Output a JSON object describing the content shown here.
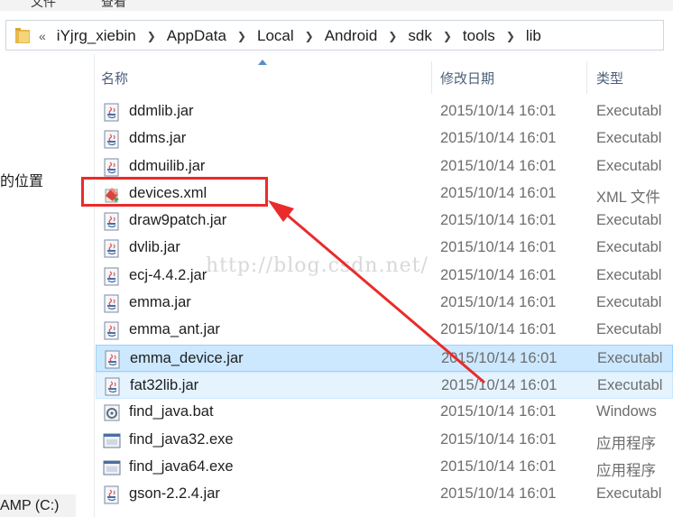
{
  "menu": {
    "items": [
      "文件",
      "查看"
    ]
  },
  "address": {
    "overflow": "«",
    "crumbs": [
      "iYjrg_xiebin",
      "AppData",
      "Local",
      "Android",
      "sdk",
      "tools",
      "lib"
    ]
  },
  "nav": {
    "location_fragment": "的位置",
    "drive_fragment": "AMP (C:)"
  },
  "columns": {
    "name": "名称",
    "date": "修改日期",
    "type": "类型"
  },
  "files": [
    {
      "name": "ddmlib.jar",
      "date": "2015/10/14 16:01",
      "type": "Executabl",
      "icon": "java-jar-icon"
    },
    {
      "name": "ddms.jar",
      "date": "2015/10/14 16:01",
      "type": "Executabl",
      "icon": "java-jar-icon"
    },
    {
      "name": "ddmuilib.jar",
      "date": "2015/10/14 16:01",
      "type": "Executabl",
      "icon": "java-jar-icon"
    },
    {
      "name": "devices.xml",
      "date": "2015/10/14 16:01",
      "type": "XML 文件",
      "icon": "xml-file-icon"
    },
    {
      "name": "draw9patch.jar",
      "date": "2015/10/14 16:01",
      "type": "Executabl",
      "icon": "java-jar-icon"
    },
    {
      "name": "dvlib.jar",
      "date": "2015/10/14 16:01",
      "type": "Executabl",
      "icon": "java-jar-icon"
    },
    {
      "name": "ecj-4.4.2.jar",
      "date": "2015/10/14 16:01",
      "type": "Executabl",
      "icon": "java-jar-icon"
    },
    {
      "name": "emma.jar",
      "date": "2015/10/14 16:01",
      "type": "Executabl",
      "icon": "java-jar-icon"
    },
    {
      "name": "emma_ant.jar",
      "date": "2015/10/14 16:01",
      "type": "Executabl",
      "icon": "java-jar-icon"
    },
    {
      "name": "emma_device.jar",
      "date": "2015/10/14 16:01",
      "type": "Executabl",
      "icon": "java-jar-icon"
    },
    {
      "name": "fat32lib.jar",
      "date": "2015/10/14 16:01",
      "type": "Executabl",
      "icon": "java-jar-icon"
    },
    {
      "name": "find_java.bat",
      "date": "2015/10/14 16:01",
      "type": "Windows",
      "icon": "batch-file-icon"
    },
    {
      "name": "find_java32.exe",
      "date": "2015/10/14 16:01",
      "type": "应用程序",
      "icon": "exe-file-icon"
    },
    {
      "name": "find_java64.exe",
      "date": "2015/10/14 16:01",
      "type": "应用程序",
      "icon": "exe-file-icon"
    },
    {
      "name": "gson-2.2.4.jar",
      "date": "2015/10/14 16:01",
      "type": "Executabl",
      "icon": "java-jar-icon"
    }
  ],
  "selected_file": "emma_device.jar",
  "hovered_file": "fat32lib.jar",
  "annotation": {
    "highlighted_file": "devices.xml",
    "color": "#ea2b2b"
  },
  "watermark": "http://blog.csdn.net/",
  "colors": {
    "selection": "#cce8ff",
    "hover": "#e5f3ff",
    "header_text": "#4c607a"
  }
}
